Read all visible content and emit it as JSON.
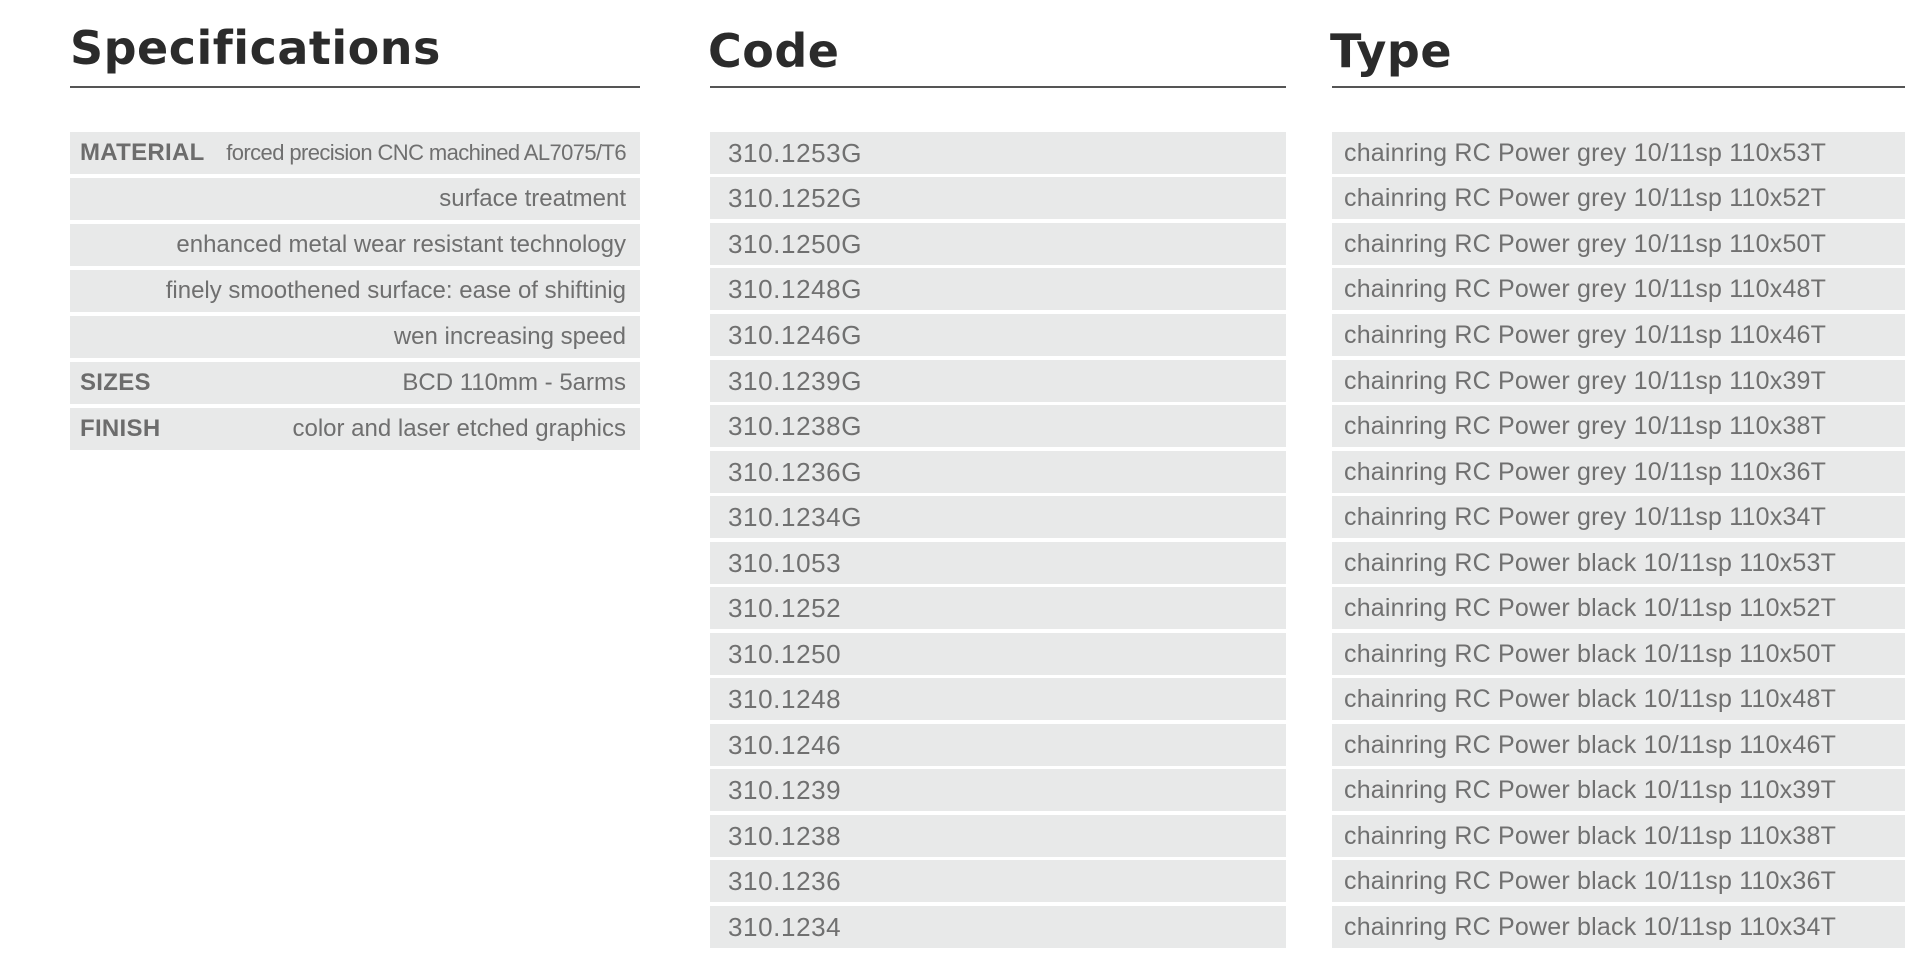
{
  "specifications": {
    "heading": "Specifications",
    "rows": [
      {
        "label": "MATERIAL",
        "value": "forced precision CNC machined AL7075/T6"
      },
      {
        "label": "",
        "value": "surface treatment"
      },
      {
        "label": "",
        "value": "enhanced metal wear resistant technology"
      },
      {
        "label": "",
        "value": "finely smoothened surface: ease of shiftinig"
      },
      {
        "label": "",
        "value": "wen increasing speed"
      },
      {
        "label": "SIZES",
        "value": "BCD 110mm - 5arms"
      },
      {
        "label": "FINISH",
        "value": "color and laser etched graphics"
      }
    ]
  },
  "code": {
    "heading": "Code",
    "items": [
      "310.1253G",
      "310.1252G",
      "310.1250G",
      "310.1248G",
      "310.1246G",
      "310.1239G",
      "310.1238G",
      "310.1236G",
      "310.1234G",
      "310.1053",
      "310.1252",
      "310.1250",
      "310.1248",
      "310.1246",
      "310.1239",
      "310.1238",
      "310.1236",
      "310.1234"
    ]
  },
  "type": {
    "heading": "Type",
    "items": [
      "chainring RC Power grey 10/11sp 110x53T",
      "chainring RC Power grey 10/11sp 110x52T",
      "chainring RC Power grey 10/11sp 110x50T",
      "chainring RC Power grey 10/11sp 110x48T",
      "chainring RC Power grey 10/11sp 110x46T",
      "chainring RC Power grey 10/11sp 110x39T",
      "chainring RC Power grey 10/11sp 110x38T",
      "chainring RC Power grey 10/11sp 110x36T",
      "chainring RC Power grey 10/11sp 110x34T",
      "chainring RC Power black 10/11sp 110x53T",
      "chainring RC Power black 10/11sp 110x52T",
      "chainring RC Power black 10/11sp 110x50T",
      "chainring RC Power black 10/11sp 110x48T",
      "chainring RC Power black 10/11sp 110x46T",
      "chainring RC Power black  10/11sp 110x39T",
      "chainring RC Power black  10/11sp 110x38T",
      "chainring RC Power black  10/11sp 110x36T",
      "chainring RC Power black 10/11sp 110x34T"
    ]
  }
}
